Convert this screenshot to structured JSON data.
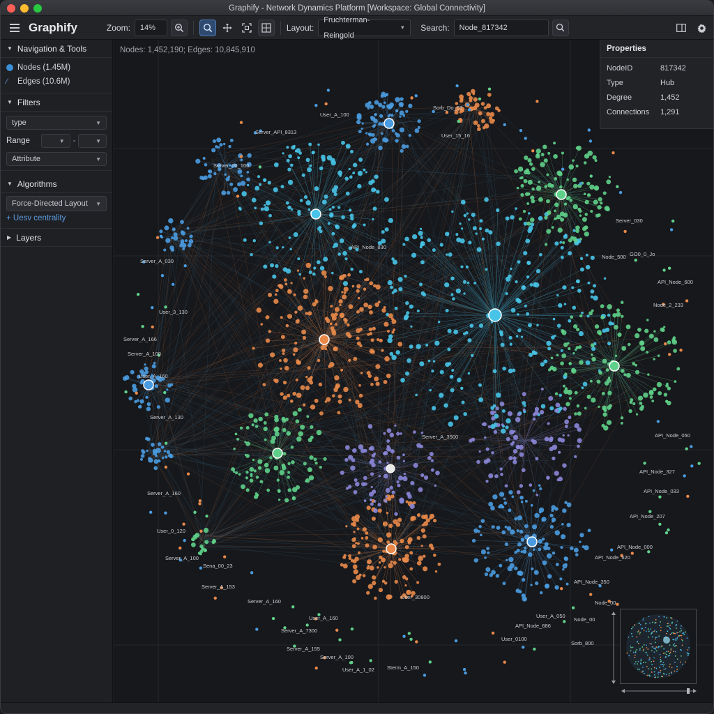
{
  "window": {
    "title": "Graphify - Network Dynamics Platform [Workspace: Global Connectivity]"
  },
  "toolbar": {
    "app_name": "Graphify",
    "zoom_label": "Zoom:",
    "zoom_value": "14%",
    "layout_label": "Layout:",
    "layout_value": "Fruchterman-Reingold",
    "search_label": "Search:",
    "search_value": "Node_817342"
  },
  "sidebar": {
    "nav_header": "Navigation & Tools",
    "nodes_legend": "Nodes (1.45M)",
    "edges_legend": "Edges (10.6M)",
    "filters_header": "Filters",
    "type_select": "type",
    "range_label": "Range",
    "range_sep": "-",
    "attribute_select": "Attribute",
    "algorithms_header": "Algorithms",
    "algorithm_select": "Force-Directed Layout",
    "add_centrality": "+ Uesv centrality",
    "layers_header": "Layers"
  },
  "canvas": {
    "stats": "Nodes: 1,452,190; Edges: 10,845,910"
  },
  "properties": {
    "title": "Properties",
    "rows": [
      {
        "key": "NodeID",
        "value": "817342"
      },
      {
        "key": "Type",
        "value": "Hub"
      },
      {
        "key": "Degree",
        "value": "1,452"
      },
      {
        "key": "Connections",
        "value": "1,291"
      }
    ]
  },
  "graph": {
    "colors": {
      "blue": "#4a9be0",
      "cyan": "#48c4e8",
      "green": "#5fd08a",
      "orange": "#e8894a",
      "purple": "#8b86d8",
      "white": "#e8e8e8",
      "edge": "#3f8fbf"
    },
    "labels": [
      "Sorb_Do_03",
      "User_A_100",
      "Server_API_8313",
      "Server_00_100",
      "Server_A_030",
      "User_3_130",
      "Server_A_166",
      "Server_A_100",
      "User_A_160",
      "Server_A_130",
      "Server_A_160",
      "User_0_120",
      "Server_A_100",
      "Sena_00_23",
      "Server_A_153",
      "Server_A_160",
      "Server_A_7300",
      "Server_A_155",
      "Server_A_100",
      "Sterm_A_150",
      "User_A_1_02",
      "User_A_160",
      "API_Node_686",
      "User_0100",
      "User_A_050",
      "Node_00",
      "Server_030",
      "GO0_0_Jo",
      "API_Node_600",
      "API_Node_050",
      "API_Node_327",
      "API_Node_033",
      "API_Node_207",
      "API_Node_000",
      "API_Node_620",
      "API_Node_350",
      "Node_00",
      "Sorb_800",
      "Node_500",
      "Node_2_233",
      "User_15_16",
      "API_Node_830",
      "Server_A_3500",
      "User_30800"
    ]
  }
}
